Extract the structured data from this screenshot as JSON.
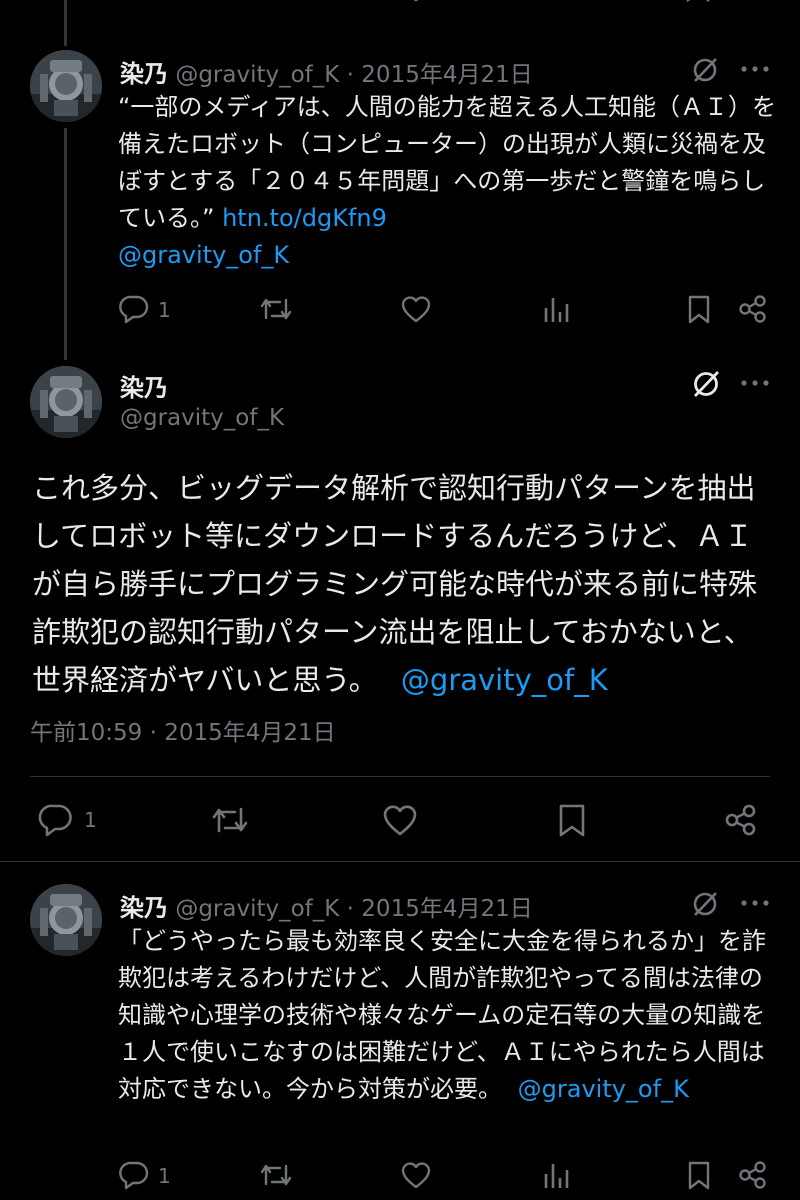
{
  "tweets": [
    {
      "name": "染乃",
      "handle": "@gravity_of_K",
      "sep": "·",
      "date": "2015年4月21日",
      "text": "“一部のメディアは、人間の能力を超える人工知能（ＡＩ）を備えたロボット（コンピューター）の出現が人類に災禍を及ぼすとする「２０４５年問題」への第一歩だと警鐘を鳴らしている。”",
      "link": "htn.to/dgKfn9",
      "mention": "@gravity_of_K",
      "reply_count": "1"
    },
    {
      "name": "染乃",
      "handle": "@gravity_of_K",
      "text": "これ多分、ビッグデータ解析で認知行動パターンを抽出してロボット等にダウンロードするんだろうけど、ＡＩが自ら勝手にプログラミング可能な時代が来る前に特殊詐欺犯の認知行動パターン流出を阻止しておかないと、世界経済がヤバいと思う。",
      "mention": "@gravity_of_K",
      "timestamp": "午前10:59 · 2015年4月21日",
      "reply_count": "1"
    },
    {
      "name": "染乃",
      "handle": "@gravity_of_K",
      "sep": "·",
      "date": "2015年4月21日",
      "text": "「どうやったら最も効率良く安全に大金を得られるか」を詐欺犯は考えるわけだけど、人間が詐欺犯やってる間は法律の知識や心理学の技術や様々なゲームの定石等の大量の知識を１人で使いこなすのは困難だけど、ＡＩにやられたら人間は対応できない。今から対策が必要。",
      "mention": "@gravity_of_K",
      "reply_count": "1"
    }
  ],
  "colors": {
    "background": "#000000",
    "text": "#e7e9ea",
    "muted": "#71767b",
    "link": "#1d9bf0",
    "divider": "#2f3336"
  },
  "icons": [
    "reply-icon",
    "retweet-icon",
    "like-icon",
    "views-icon",
    "bookmark-icon",
    "share-icon",
    "grok-icon",
    "more-icon"
  ]
}
